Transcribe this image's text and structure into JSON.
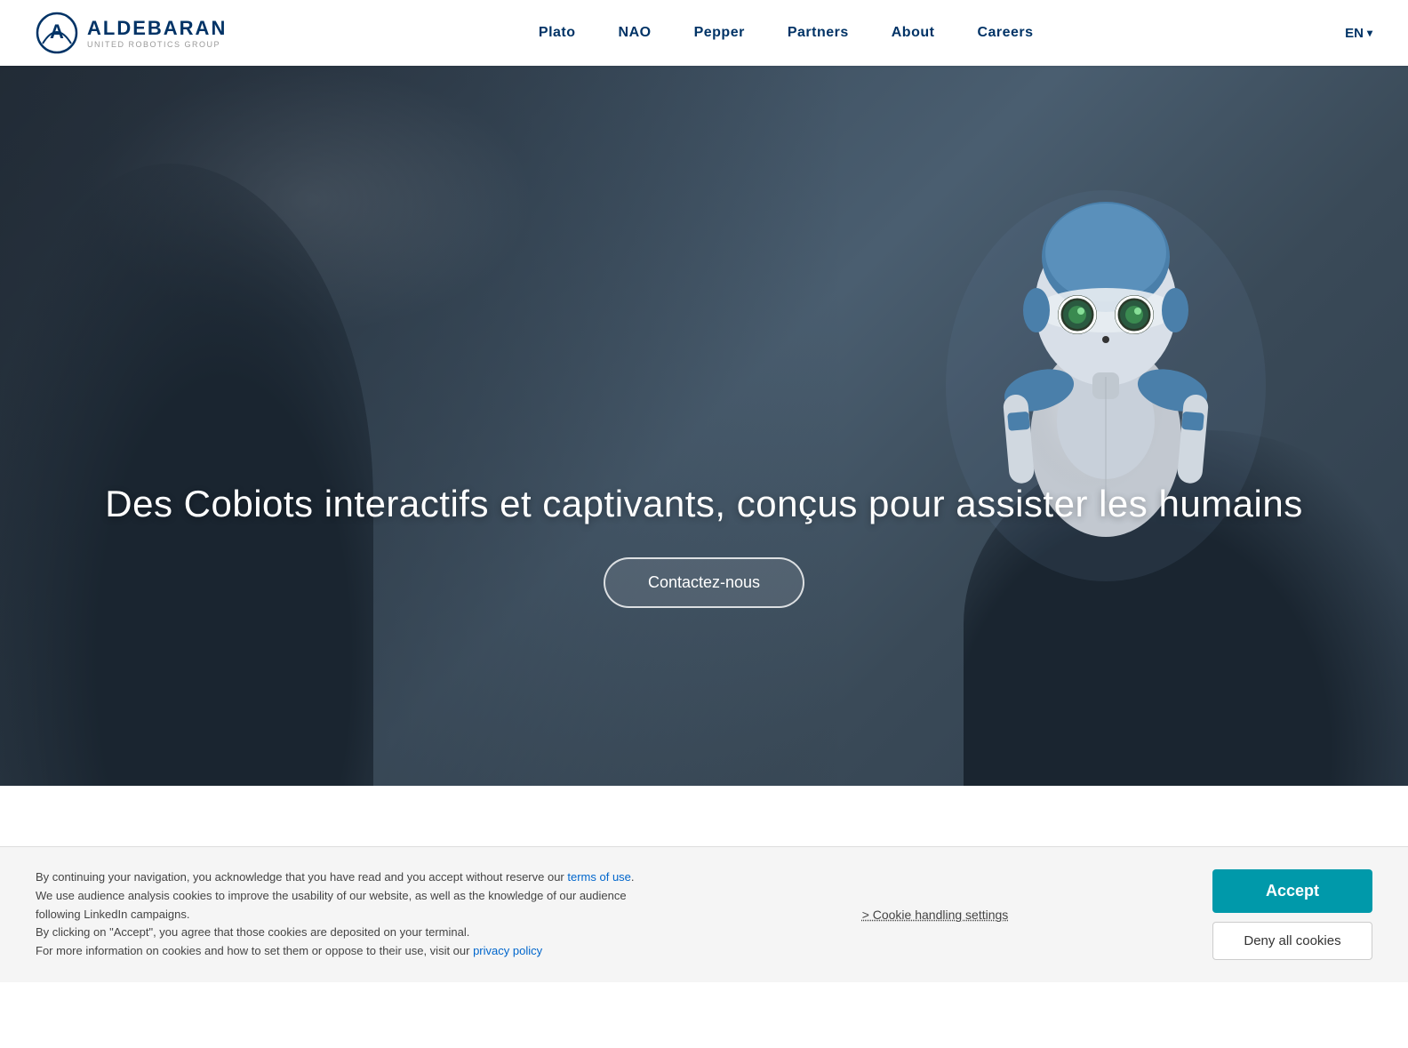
{
  "header": {
    "logo_brand": "ALDEBARAN",
    "logo_sub": "UNITED ROBOTICS GROUP",
    "lang": "EN",
    "nav": [
      {
        "id": "plato",
        "label": "Plato"
      },
      {
        "id": "nao",
        "label": "NAO"
      },
      {
        "id": "pepper",
        "label": "Pepper"
      },
      {
        "id": "partners",
        "label": "Partners"
      },
      {
        "id": "about",
        "label": "About"
      },
      {
        "id": "careers",
        "label": "Careers"
      }
    ]
  },
  "hero": {
    "title": "Des Cobiots interactifs et captivants, conçus pour assister les humains",
    "cta_label": "Contactez-nous"
  },
  "cookie_banner": {
    "text_main": "By continuing your navigation, you acknowledge that you have read and you accept without reserve our ",
    "terms_link_text": "terms of use",
    "text_mid": ".\nWe use audience analysis cookies to improve the usability of our website, as well as the knowledge of our audience following LinkedIn campaigns.\nBy clicking on \"Accept\", you agree that those cookies are deposited on your terminal.\nFor more information on cookies and how to set them or oppose to their use, visit our ",
    "privacy_link_text": "privacy policy",
    "settings_label": "> Cookie handling settings",
    "accept_label": "Accept",
    "deny_label": "Deny all cookies"
  },
  "colors": {
    "brand_blue": "#003366",
    "teal": "#0099aa",
    "nav_text": "#003366"
  }
}
